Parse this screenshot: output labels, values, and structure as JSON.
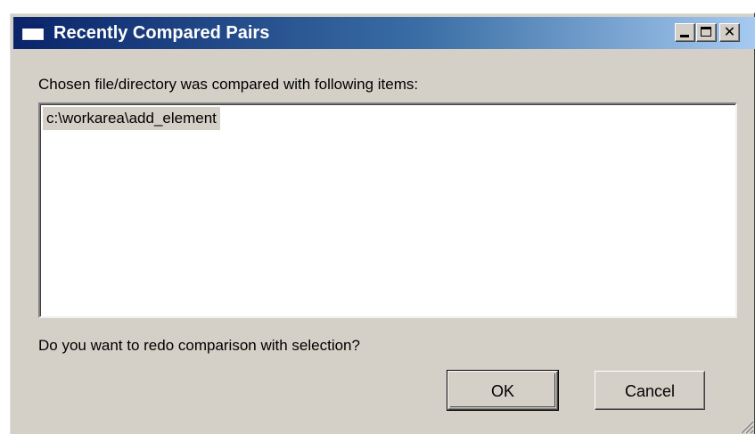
{
  "window": {
    "title": "Recently Compared Pairs",
    "controls": {
      "minimize": "minimize-icon",
      "maximize": "maximize-icon",
      "close": "close-icon"
    }
  },
  "dialog": {
    "intro_text": "Chosen file/directory was compared with following items:",
    "items": [
      "c:\\workarea\\add_element"
    ],
    "selected_index": 0,
    "question_text": "Do you want to redo comparison with selection?",
    "ok_label": "OK",
    "cancel_label": "Cancel"
  },
  "colors": {
    "face": "#d4d0c8",
    "title_start": "#0a246a",
    "title_end": "#a6caf0",
    "selection": "#d4d0c8"
  }
}
